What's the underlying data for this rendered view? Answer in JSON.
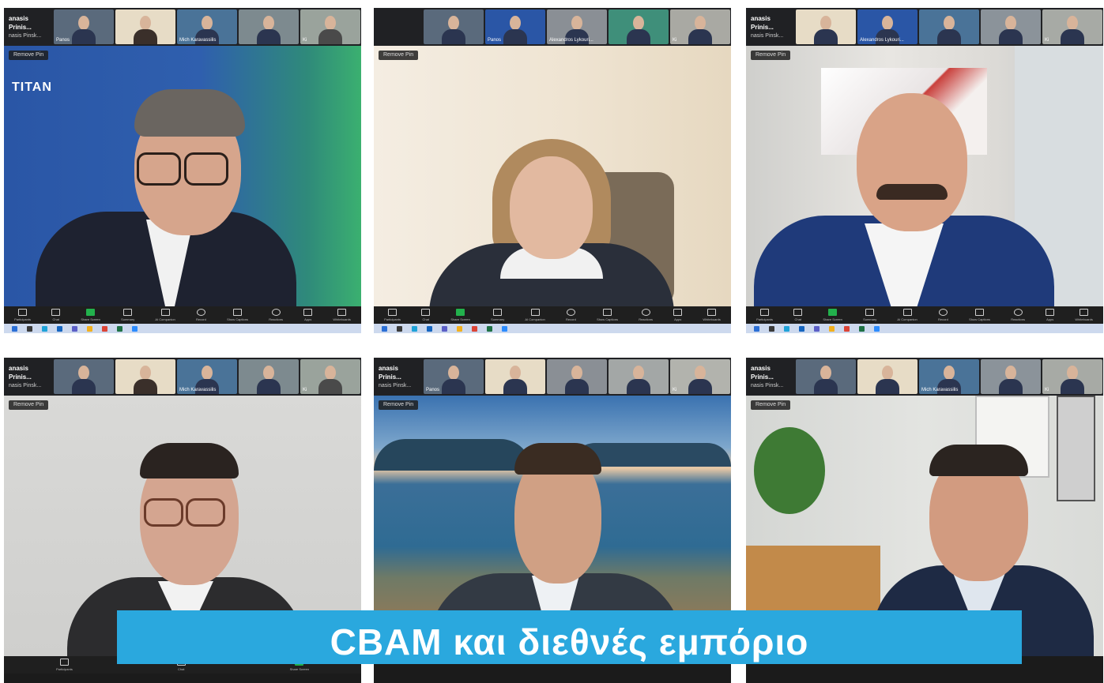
{
  "panels": [
    {
      "strip_name": "anasis Prinis...",
      "strip_sub": "nasis Pinsk...",
      "thumbs": [
        "Panos",
        "",
        "Mich Karavassilis",
        "",
        "Ki"
      ],
      "remove_pin": "Remove Pin",
      "logo": "TITAN"
    },
    {
      "strip_name": "",
      "strip_sub": "",
      "thumbs": [
        "",
        "Panos",
        "Alexandros Lykouri...",
        "",
        "Ki"
      ],
      "remove_pin": "Remove Pin",
      "logo": ""
    },
    {
      "strip_name": "anasis Prinis...",
      "strip_sub": "nasis Pinsk...",
      "thumbs": [
        "",
        "Alexandros Lykouri...",
        "",
        "",
        "Ki"
      ],
      "remove_pin": "Remove Pin",
      "logo": ""
    },
    {
      "strip_name": "anasis Prinis...",
      "strip_sub": "nasis Pinsk...",
      "thumbs": [
        "",
        "",
        "Mich Karavassilis",
        "",
        "Ki"
      ],
      "remove_pin": "Remove Pin",
      "logo": ""
    },
    {
      "strip_name": "anasis Prinis...",
      "strip_sub": "nasis Pinsk...",
      "thumbs": [
        "Panos",
        "",
        "",
        "",
        "Ki"
      ],
      "remove_pin": "Remove Pin",
      "logo": ""
    },
    {
      "strip_name": "anasis Prinis...",
      "strip_sub": "nasis Pinsk...",
      "thumbs": [
        "",
        "",
        "Mich Karavassilis",
        "",
        "Ki"
      ],
      "remove_pin": "Remove Pin",
      "logo": ""
    }
  ],
  "toolbar": [
    {
      "label": "Participants",
      "icon": "participants-icon"
    },
    {
      "label": "Chat",
      "icon": "chat-icon"
    },
    {
      "label": "Share Screen",
      "icon": "share-screen-icon"
    },
    {
      "label": "Summary",
      "icon": "summary-icon"
    },
    {
      "label": "AI Companion",
      "icon": "ai-companion-icon"
    },
    {
      "label": "Record",
      "icon": "record-icon"
    },
    {
      "label": "Show Captions",
      "icon": "captions-icon"
    },
    {
      "label": "Reactions",
      "icon": "reactions-icon"
    },
    {
      "label": "Apps",
      "icon": "apps-icon"
    },
    {
      "label": "Whiteboards",
      "icon": "whiteboards-icon"
    }
  ],
  "colors": {
    "caption_bg": "#2aa8de",
    "share_green": "#22b14c",
    "taskbar": "#cdd9ee"
  },
  "caption": {
    "text": "CBAM και διεθνές εμπόριο"
  }
}
